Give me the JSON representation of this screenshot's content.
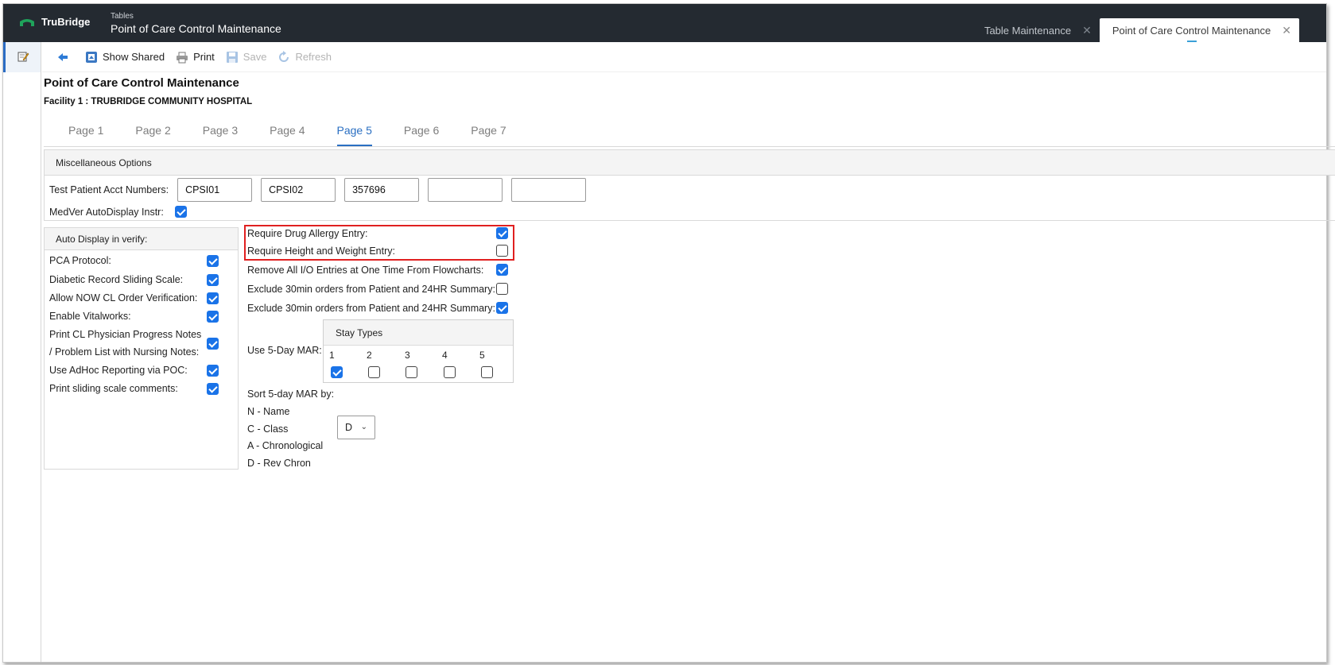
{
  "app": {
    "brand": "TruBridge",
    "crumb_small": "Tables",
    "crumb_title": "Point of Care Control Maintenance"
  },
  "tabs": [
    {
      "label": "Table Maintenance",
      "close": "✕"
    },
    {
      "label": "Point of Care Control Maintenance",
      "close": "✕"
    }
  ],
  "toolbar": {
    "back_icon": "back-arrow-icon",
    "show_shared": "Show Shared",
    "print": "Print",
    "save": "Save",
    "refresh": "Refresh"
  },
  "header": {
    "title": "Point of Care Control Maintenance",
    "facility": "Facility 1 : TRUBRIDGE COMMUNITY HOSPITAL"
  },
  "pages": [
    "Page 1",
    "Page 2",
    "Page 3",
    "Page 4",
    "Page 5",
    "Page 6",
    "Page 7"
  ],
  "active_page": "Page 5",
  "misc": {
    "heading": "Miscellaneous Options",
    "acct_label": "Test Patient Acct Numbers:",
    "acct_values": [
      "CPSI01",
      "CPSI02",
      "357696",
      "",
      ""
    ],
    "medver_label": "MedVer AutoDisplay Instr:",
    "medver_checked": true
  },
  "auto_display": {
    "heading": "Auto Display in verify:",
    "items": [
      {
        "label": "PCA Protocol:",
        "checked": true
      },
      {
        "label": "Diabetic Record Sliding Scale:",
        "checked": true
      },
      {
        "label": "Allow NOW CL Order Verification:",
        "checked": true
      },
      {
        "label": "Enable Vitalworks:",
        "checked": true
      },
      {
        "label_line1": "Print CL Physician Progress Notes",
        "label_line2": "/ Problem List with Nursing Notes:",
        "checked": true
      },
      {
        "label": "Use AdHoc Reporting via POC:",
        "checked": true
      },
      {
        "label": "Print sliding scale comments:",
        "checked": true
      }
    ]
  },
  "options": [
    {
      "label": "Require Drug Allergy Entry:",
      "checked": true
    },
    {
      "label": "Require Height and Weight Entry:",
      "checked": false
    },
    {
      "label": "Remove All I/O Entries at One Time From Flowcharts:",
      "checked": true
    },
    {
      "label": "Exclude 30min orders from Patient and 24HR Summary:",
      "checked": false
    },
    {
      "label": "Exclude 30min orders from Patient and 24HR Summary:",
      "checked": true
    }
  ],
  "mar": {
    "label": "Use 5-Day MAR:",
    "stay_heading": "Stay Types",
    "stay_types": [
      {
        "num": "1",
        "checked": true
      },
      {
        "num": "2",
        "checked": false
      },
      {
        "num": "3",
        "checked": false
      },
      {
        "num": "4",
        "checked": false
      },
      {
        "num": "5",
        "checked": false
      }
    ]
  },
  "sort": {
    "heading": "Sort 5-day MAR by:",
    "options": [
      "N - Name",
      "C - Class",
      "A - Chronological",
      "D - Rev Chron"
    ],
    "selected": "D"
  },
  "colors": {
    "topbar": "#242a31",
    "accent": "#1a73e8",
    "tab_active": "#2a6fc2",
    "highlight": "#e02020"
  }
}
